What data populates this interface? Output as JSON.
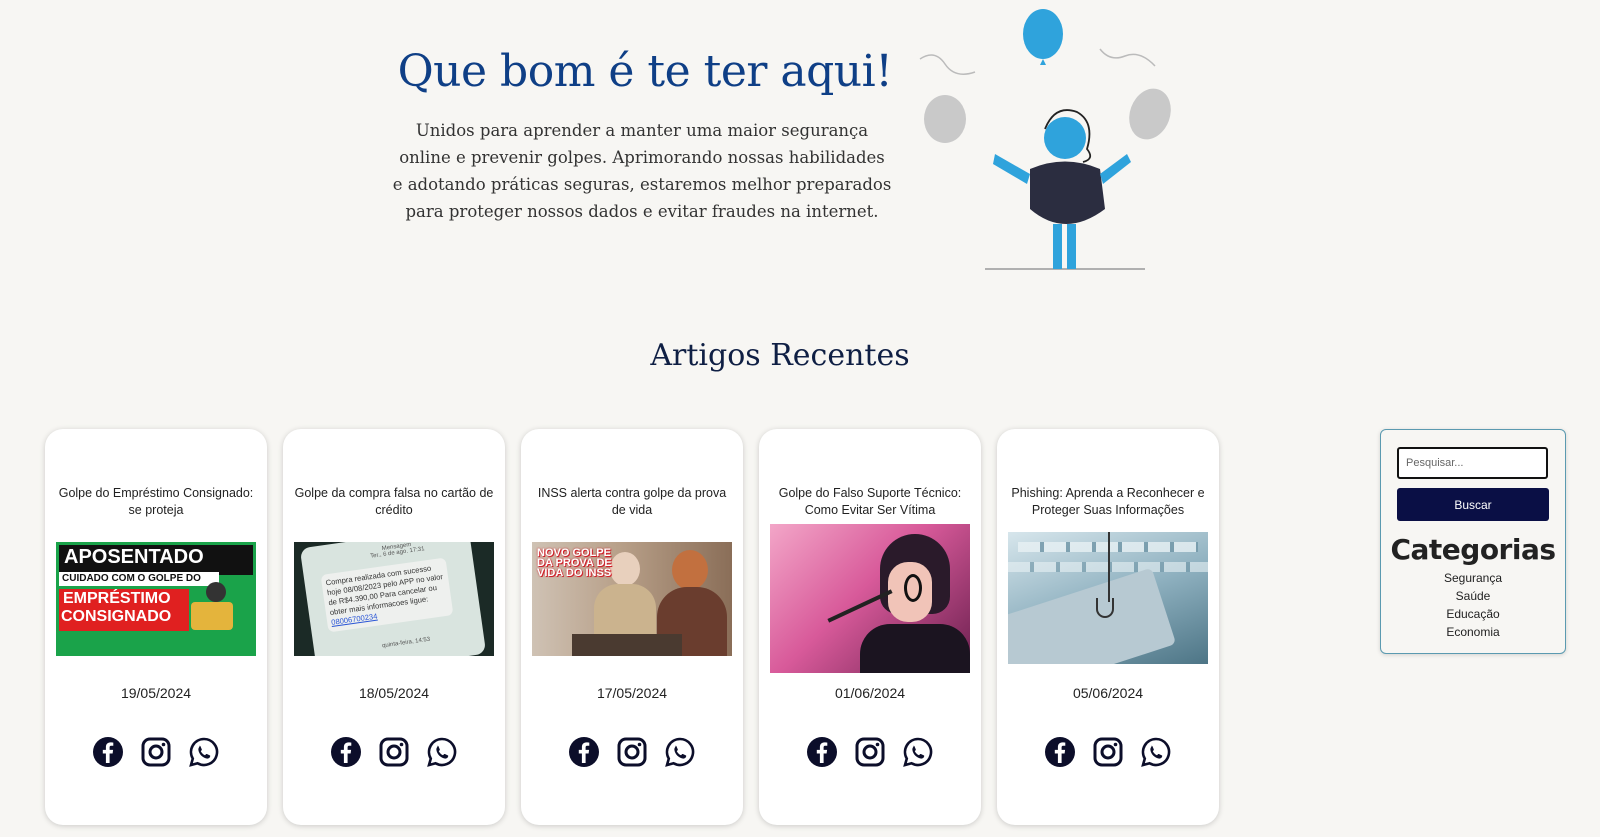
{
  "hero": {
    "title": "Que bom é te ter aqui!",
    "text": "Unidos para aprender a manter uma maior segurança online e prevenir golpes. Aprimorando nossas habilidades e adotando práticas seguras, estaremos melhor preparados para proteger nossos dados e evitar fraudes na internet."
  },
  "section": {
    "title": "Artigos Recentes"
  },
  "articles": [
    {
      "title": "Golpe do Empréstimo Consignado: se proteja",
      "date": "19/05/2024",
      "image_text": {
        "line1": "APOSENTADO",
        "line2": "CUIDADO COM O GOLPE DO",
        "line3": "EMPRÉSTIMO",
        "line4": "CONSIGNADO"
      }
    },
    {
      "title": "Golpe da compra falsa no cartão de crédito",
      "date": "18/05/2024",
      "image_text": {
        "header": "Mensagem",
        "sub": "Ter., 6 de ago. 17:31",
        "sms": "Compra realizada com sucesso hoje 08/08/2023 pelo APP no valor de R$4.390,00 Para cancelar ou obter mais informacoes ligue:",
        "phone": "08006700234",
        "footer": "quinta-feira, 14:53"
      }
    },
    {
      "title": "INSS alerta contra golpe da prova de vida",
      "date": "17/05/2024",
      "image_text": {
        "line1": "NOVO GOLPE",
        "line2": "DA PROVA DE",
        "line3": "VIDA DO INSS"
      }
    },
    {
      "title": "Golpe do Falso Suporte Técnico: Como Evitar Ser Vítima",
      "date": "01/06/2024"
    },
    {
      "title": "Phishing: Aprenda a Reconhecer e Proteger Suas Informações",
      "date": "05/06/2024"
    }
  ],
  "sidebar": {
    "search_placeholder": "Pesquisar...",
    "search_button": "Buscar",
    "categories_title": "Categorias",
    "categories": [
      "Segurança",
      "Saúde",
      "Educação",
      "Economia"
    ]
  },
  "colors": {
    "accent": "#0f3f86",
    "button": "#0a0f45",
    "illustration_blue": "#2fa3dc"
  }
}
